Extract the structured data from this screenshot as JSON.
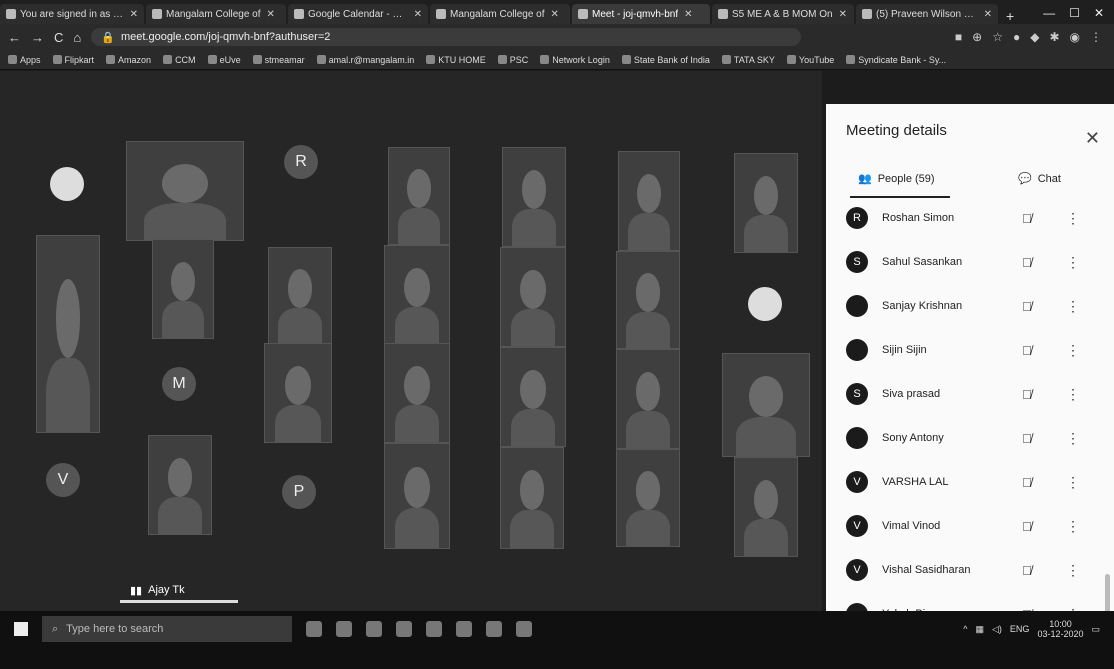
{
  "browser": {
    "tabs": [
      {
        "label": "You are signed in as an"
      },
      {
        "label": "Mangalam College of"
      },
      {
        "label": "Google Calendar - Thu"
      },
      {
        "label": "Mangalam College of"
      },
      {
        "label": "Meet - joj-qmvh-bnf",
        "active": true
      },
      {
        "label": "S5 ME A & B MOM On"
      },
      {
        "label": "(5) Praveen Wilson Pro"
      }
    ],
    "url": "meet.google.com/joj-qmvh-bnf?authuser=2",
    "bookmarks": [
      "Apps",
      "Flipkart",
      "Amazon",
      "CCM",
      "eUve",
      "stmeamar",
      "amal.r@mangalam.in",
      "KTU HOME",
      "PSC",
      "Network Login",
      "State Bank of India",
      "TATA SKY",
      "YouTube",
      "Syndicate Bank - Sy..."
    ]
  },
  "meeting": {
    "avatars": {
      "r": "R",
      "m": "M",
      "v": "V",
      "p": "P"
    },
    "speaker_name": "Ajay Tk"
  },
  "panel": {
    "title": "Meeting details",
    "tab_people": "People (59)",
    "tab_chat": "Chat",
    "participants": [
      {
        "initial": "R",
        "name": "Roshan Simon"
      },
      {
        "initial": "S",
        "name": "Sahul Sasankan"
      },
      {
        "initial": "",
        "name": "Sanjay Krishnan"
      },
      {
        "initial": "",
        "name": "Sijin Sijin"
      },
      {
        "initial": "S",
        "name": "Siva prasad"
      },
      {
        "initial": "",
        "name": "Sony Antony"
      },
      {
        "initial": "V",
        "name": "VARSHA LAL"
      },
      {
        "initial": "V",
        "name": "Vimal Vinod"
      },
      {
        "initial": "V",
        "name": "Vishal Sasidharan"
      },
      {
        "initial": "",
        "name": "Yakob Binoy"
      }
    ]
  },
  "taskbar": {
    "search_placeholder": "Type here to search",
    "lang": "ENG",
    "time": "10:00",
    "date": "03-12-2020"
  }
}
